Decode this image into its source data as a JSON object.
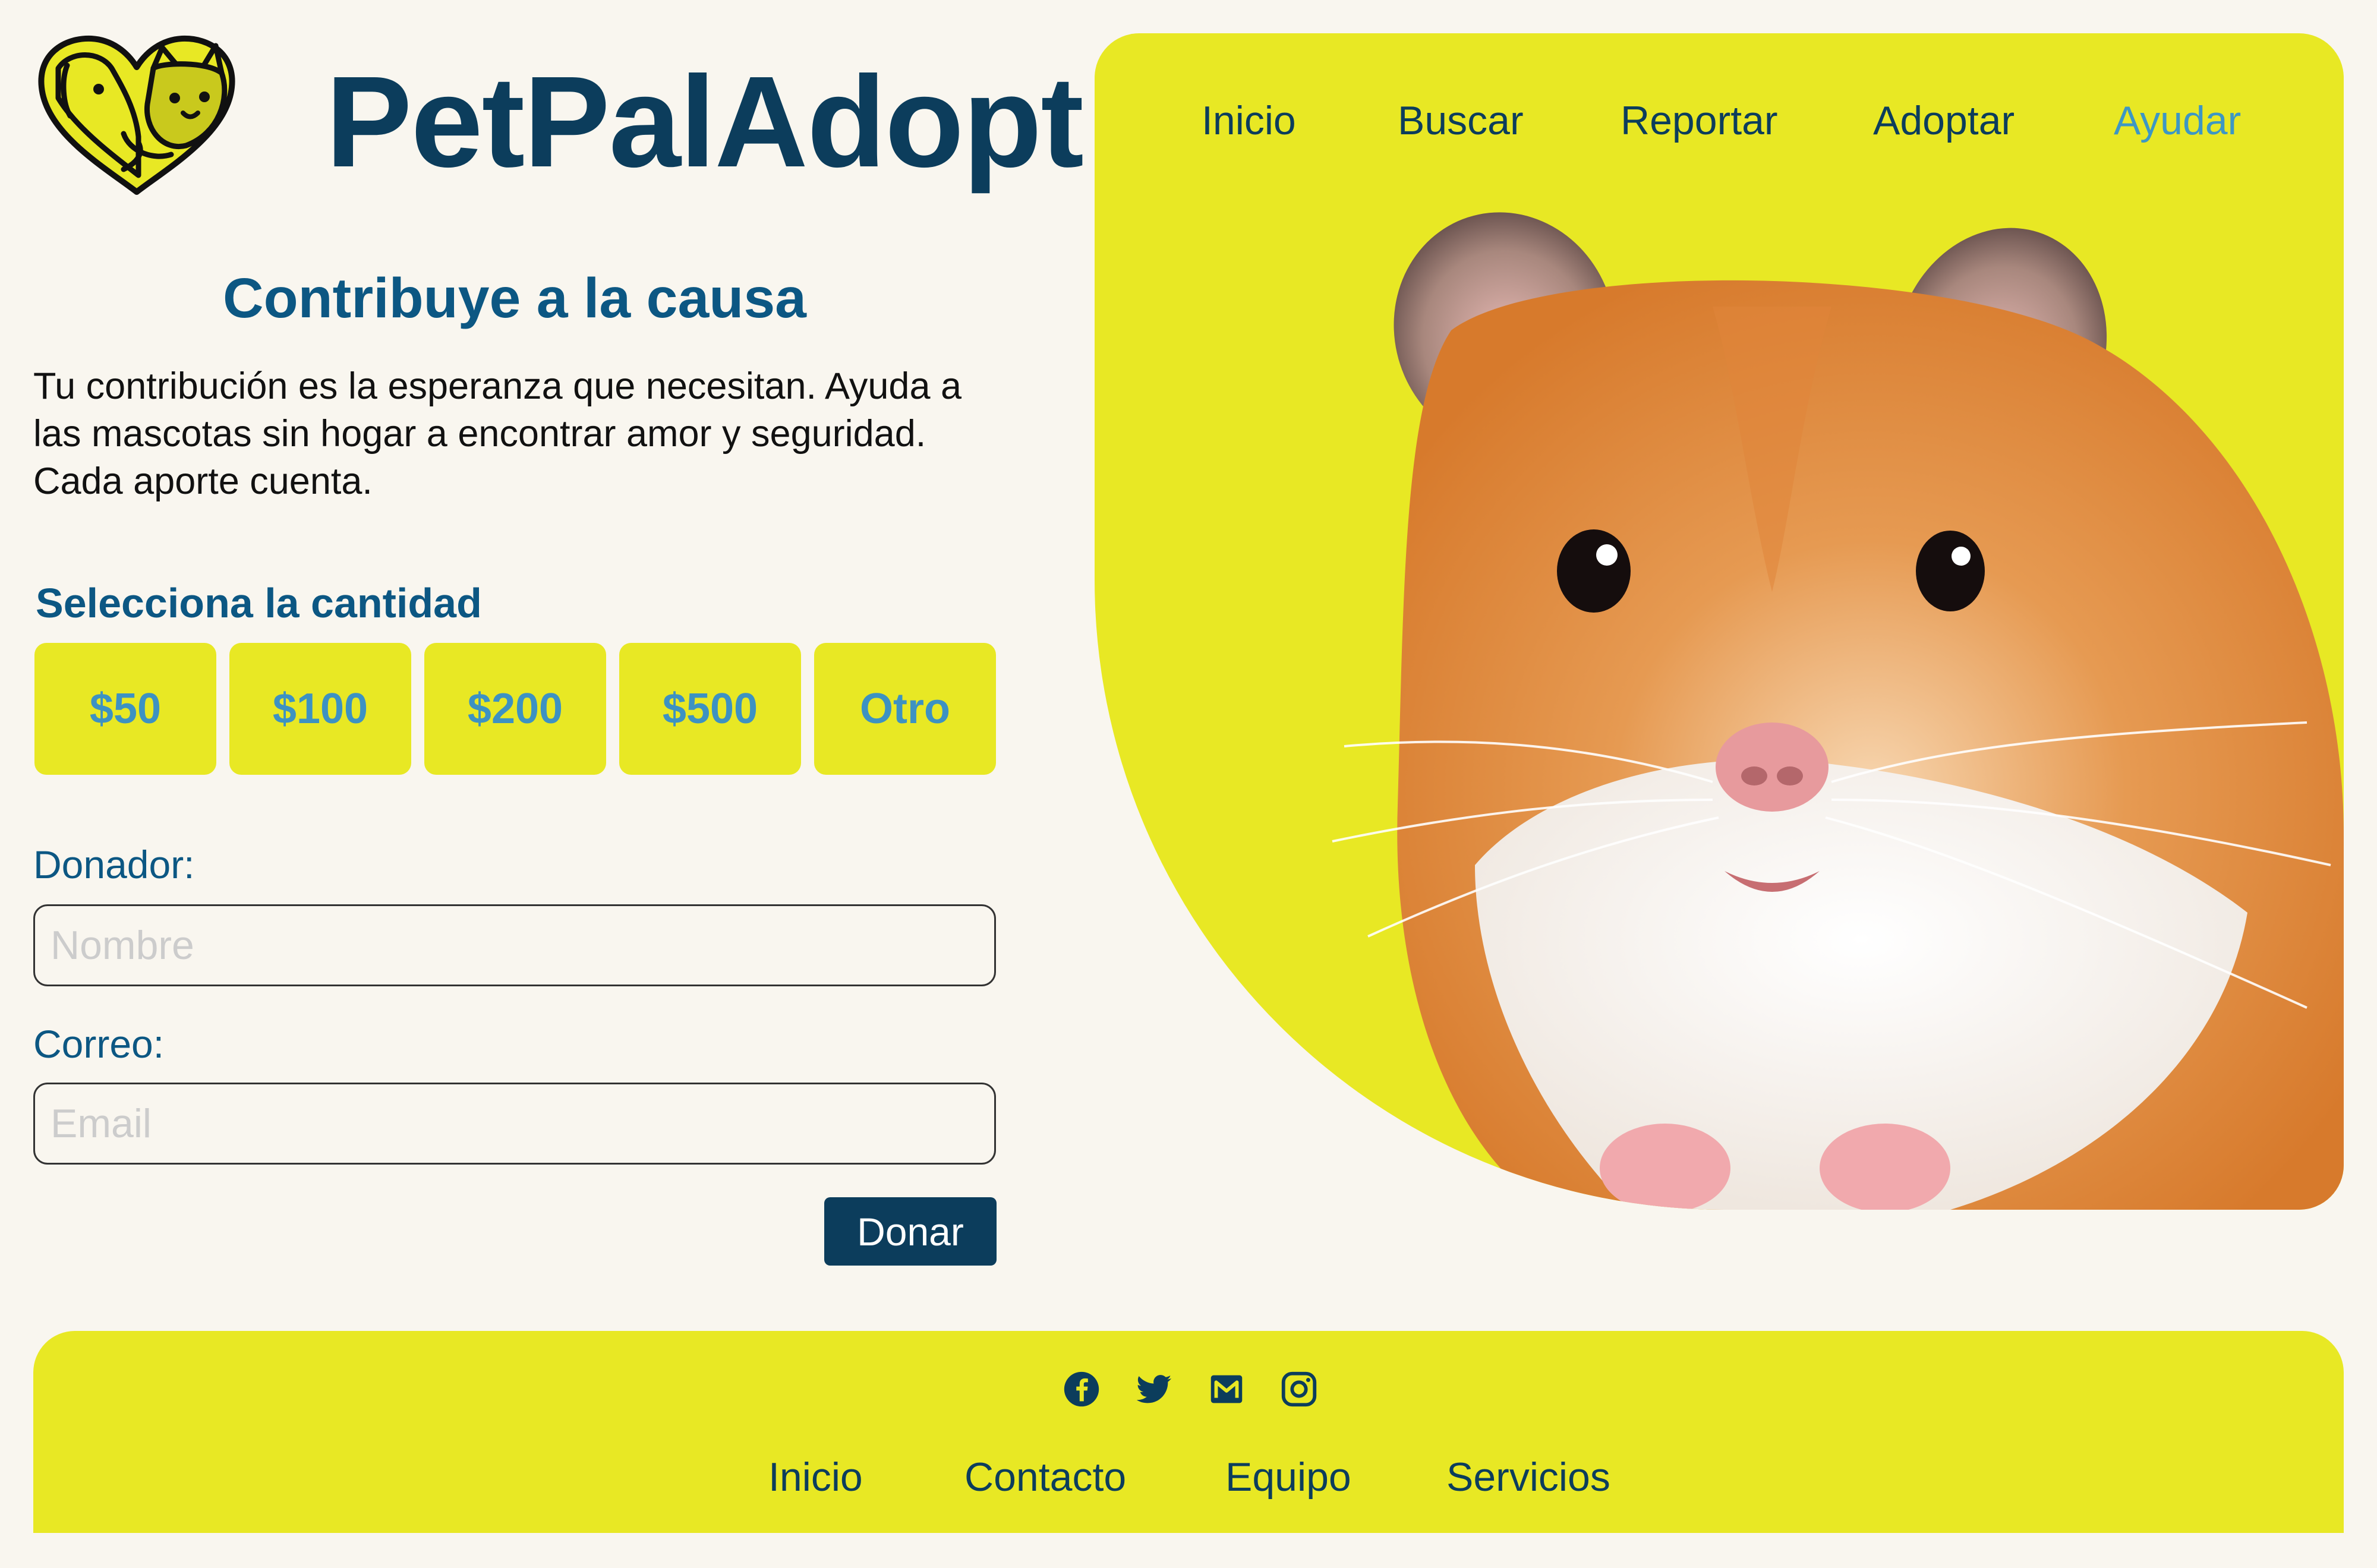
{
  "brand": {
    "name": "PetPalAdopt",
    "logo_icon": "heart-dog-cat-logo-icon"
  },
  "nav": {
    "items": [
      "Inicio",
      "Buscar",
      "Reportar",
      "Adoptar",
      "Ayudar"
    ],
    "active_index": 4
  },
  "hero": {
    "image": "hamster-photo"
  },
  "content": {
    "title": "Contribuye a la causa",
    "description": "Tu contribución es la esperanza que necesitan. Ayuda a las mascotas sin hogar a encontrar amor y seguridad. Cada aporte cuenta.",
    "amount_label": "Selecciona la cantidad",
    "amounts": [
      "$50",
      "$100",
      "$200",
      "$500",
      "Otro"
    ]
  },
  "form": {
    "donor_label": "Donador:",
    "donor_placeholder": "Nombre",
    "email_label": "Correo:",
    "email_placeholder": "Email",
    "submit_label": "Donar"
  },
  "footer": {
    "social_icons": [
      "facebook-icon",
      "twitter-icon",
      "gmail-icon",
      "instagram-icon"
    ],
    "links": [
      "Inicio",
      "Contacto",
      "Equipo",
      "Servicios"
    ]
  },
  "colors": {
    "accent_yellow": "#e8e824",
    "navy": "#0c3d5c",
    "title_blue": "#0c5783",
    "active_nav": "#3d97c4",
    "amount_text": "#3d92c2",
    "background": "#f9f6ef"
  }
}
